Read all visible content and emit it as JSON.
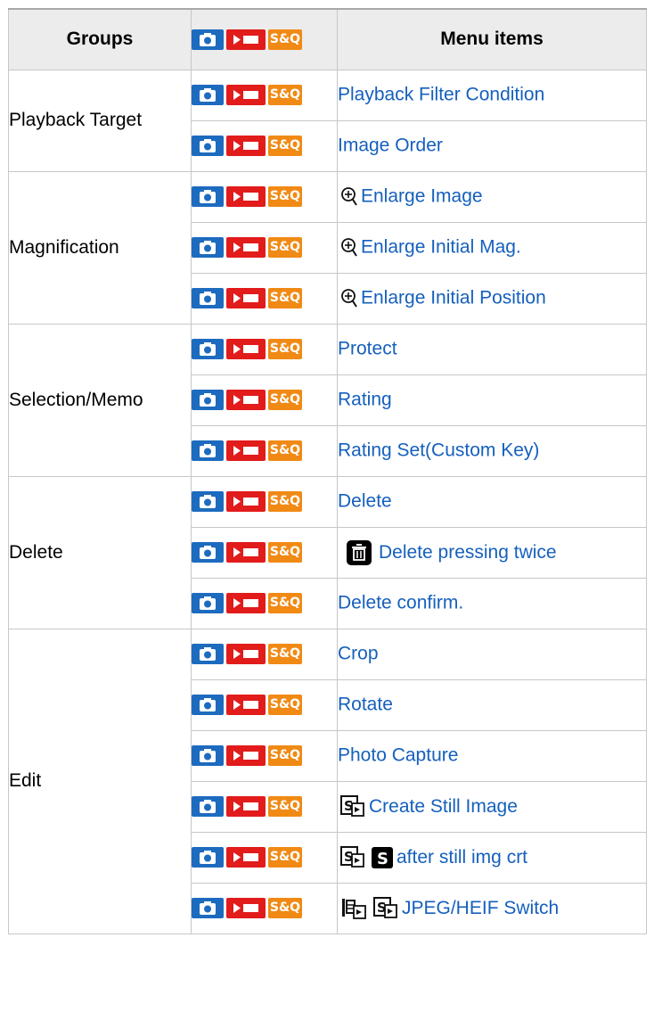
{
  "header": {
    "groups": "Groups",
    "menu_items": "Menu items",
    "sq_label": "S&Q"
  },
  "mode_icons": {
    "photo": "camera-icon",
    "movie": "movie-icon",
    "sq_text": "S&Q",
    "colors": {
      "photo": "#1d6bbf",
      "movie": "#e21b1b",
      "sq": "#f08a15"
    }
  },
  "link_color": "#1560bd",
  "groups": [
    {
      "name": "Playback Target",
      "items": [
        "Playback Filter Condition",
        "Image Order"
      ]
    },
    {
      "name": "Magnification",
      "items": [
        "Enlarge Image",
        "Enlarge Initial Mag.",
        "Enlarge Initial Position"
      ]
    },
    {
      "name": "Selection/Memo",
      "items": [
        "Protect",
        "Rating",
        "Rating Set(Custom Key)"
      ]
    },
    {
      "name": "Delete",
      "items": [
        "Delete",
        "Delete pressing twice",
        "Delete confirm."
      ]
    },
    {
      "name": "Edit",
      "items": [
        "Crop",
        "Rotate",
        "Photo Capture",
        "Create Still Image",
        "after still img crt",
        "JPEG/HEIF Switch"
      ]
    }
  ],
  "item_icons": {
    "magnify": "magnify-plus-icon",
    "trash": "trash-icon",
    "still_image": "still-image-icon",
    "s_mark": "s-mark-icon",
    "film_switch": "film-switch-icon"
  }
}
